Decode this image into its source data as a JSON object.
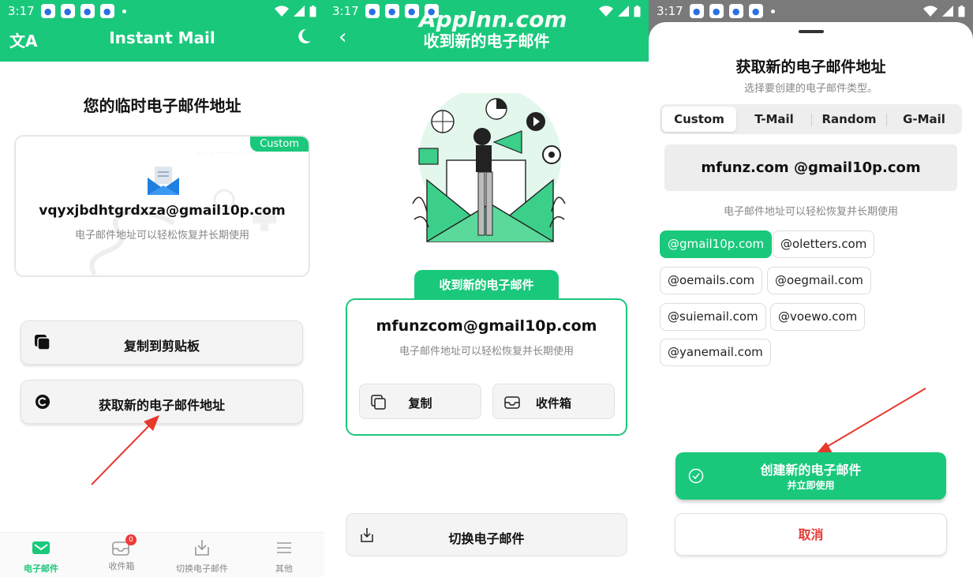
{
  "status": {
    "time": "3:17"
  },
  "watermark": "AppInn.com",
  "panel1": {
    "title": "Instant Mail",
    "heading": "您的临时电子邮件地址",
    "badge": "Custom",
    "email": "vqyxjbdhtgrdxza@gmail10p.com",
    "hint": "电子邮件地址可以轻松恢复并长期使用",
    "copy_label": "复制到剪贴板",
    "new_label": "获取新的电子邮件地址",
    "nav": [
      {
        "label": "电子邮件"
      },
      {
        "label": "收件箱",
        "badge": "0"
      },
      {
        "label": "切换电子邮件"
      },
      {
        "label": "其他"
      }
    ]
  },
  "panel2": {
    "title": "收到新的电子邮件",
    "tab_label": "收到新的电子邮件",
    "email": "mfunzcom@gmail10p.com",
    "hint": "电子邮件地址可以轻松恢复并长期使用",
    "copy_label": "复制",
    "inbox_label": "收件箱",
    "switch_label": "切换电子邮件"
  },
  "panel3": {
    "title": "获取新的电子邮件地址",
    "subtitle": "选择要创建的电子邮件类型。",
    "tabs": [
      "Custom",
      "T-Mail",
      "Random",
      "G-Mail"
    ],
    "preview": "mfunz.com @gmail10p.com",
    "preview_hint": "电子邮件地址可以轻松恢复并长期使用",
    "domains": [
      "@gmail10p.com",
      "@oletters.com",
      "@oemails.com",
      "@oegmail.com",
      "@suiemail.com",
      "@voewo.com",
      "@yanemail.com"
    ],
    "create_line1": "创建新的电子邮件",
    "create_line2": "并立即使用",
    "cancel_label": "取消"
  },
  "colors": {
    "accent": "#1ac87c",
    "danger": "#e53935",
    "arrow": "#e8382c"
  }
}
